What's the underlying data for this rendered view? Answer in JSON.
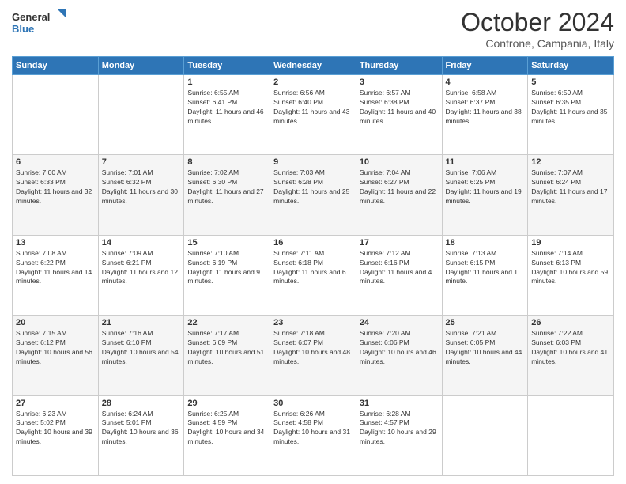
{
  "header": {
    "logo_line1": "General",
    "logo_line2": "Blue",
    "month": "October 2024",
    "location": "Controne, Campania, Italy"
  },
  "days_of_week": [
    "Sunday",
    "Monday",
    "Tuesday",
    "Wednesday",
    "Thursday",
    "Friday",
    "Saturday"
  ],
  "weeks": [
    [
      {
        "day": "",
        "info": ""
      },
      {
        "day": "",
        "info": ""
      },
      {
        "day": "1",
        "info": "Sunrise: 6:55 AM\nSunset: 6:41 PM\nDaylight: 11 hours and 46 minutes."
      },
      {
        "day": "2",
        "info": "Sunrise: 6:56 AM\nSunset: 6:40 PM\nDaylight: 11 hours and 43 minutes."
      },
      {
        "day": "3",
        "info": "Sunrise: 6:57 AM\nSunset: 6:38 PM\nDaylight: 11 hours and 40 minutes."
      },
      {
        "day": "4",
        "info": "Sunrise: 6:58 AM\nSunset: 6:37 PM\nDaylight: 11 hours and 38 minutes."
      },
      {
        "day": "5",
        "info": "Sunrise: 6:59 AM\nSunset: 6:35 PM\nDaylight: 11 hours and 35 minutes."
      }
    ],
    [
      {
        "day": "6",
        "info": "Sunrise: 7:00 AM\nSunset: 6:33 PM\nDaylight: 11 hours and 32 minutes."
      },
      {
        "day": "7",
        "info": "Sunrise: 7:01 AM\nSunset: 6:32 PM\nDaylight: 11 hours and 30 minutes."
      },
      {
        "day": "8",
        "info": "Sunrise: 7:02 AM\nSunset: 6:30 PM\nDaylight: 11 hours and 27 minutes."
      },
      {
        "day": "9",
        "info": "Sunrise: 7:03 AM\nSunset: 6:28 PM\nDaylight: 11 hours and 25 minutes."
      },
      {
        "day": "10",
        "info": "Sunrise: 7:04 AM\nSunset: 6:27 PM\nDaylight: 11 hours and 22 minutes."
      },
      {
        "day": "11",
        "info": "Sunrise: 7:06 AM\nSunset: 6:25 PM\nDaylight: 11 hours and 19 minutes."
      },
      {
        "day": "12",
        "info": "Sunrise: 7:07 AM\nSunset: 6:24 PM\nDaylight: 11 hours and 17 minutes."
      }
    ],
    [
      {
        "day": "13",
        "info": "Sunrise: 7:08 AM\nSunset: 6:22 PM\nDaylight: 11 hours and 14 minutes."
      },
      {
        "day": "14",
        "info": "Sunrise: 7:09 AM\nSunset: 6:21 PM\nDaylight: 11 hours and 12 minutes."
      },
      {
        "day": "15",
        "info": "Sunrise: 7:10 AM\nSunset: 6:19 PM\nDaylight: 11 hours and 9 minutes."
      },
      {
        "day": "16",
        "info": "Sunrise: 7:11 AM\nSunset: 6:18 PM\nDaylight: 11 hours and 6 minutes."
      },
      {
        "day": "17",
        "info": "Sunrise: 7:12 AM\nSunset: 6:16 PM\nDaylight: 11 hours and 4 minutes."
      },
      {
        "day": "18",
        "info": "Sunrise: 7:13 AM\nSunset: 6:15 PM\nDaylight: 11 hours and 1 minute."
      },
      {
        "day": "19",
        "info": "Sunrise: 7:14 AM\nSunset: 6:13 PM\nDaylight: 10 hours and 59 minutes."
      }
    ],
    [
      {
        "day": "20",
        "info": "Sunrise: 7:15 AM\nSunset: 6:12 PM\nDaylight: 10 hours and 56 minutes."
      },
      {
        "day": "21",
        "info": "Sunrise: 7:16 AM\nSunset: 6:10 PM\nDaylight: 10 hours and 54 minutes."
      },
      {
        "day": "22",
        "info": "Sunrise: 7:17 AM\nSunset: 6:09 PM\nDaylight: 10 hours and 51 minutes."
      },
      {
        "day": "23",
        "info": "Sunrise: 7:18 AM\nSunset: 6:07 PM\nDaylight: 10 hours and 48 minutes."
      },
      {
        "day": "24",
        "info": "Sunrise: 7:20 AM\nSunset: 6:06 PM\nDaylight: 10 hours and 46 minutes."
      },
      {
        "day": "25",
        "info": "Sunrise: 7:21 AM\nSunset: 6:05 PM\nDaylight: 10 hours and 44 minutes."
      },
      {
        "day": "26",
        "info": "Sunrise: 7:22 AM\nSunset: 6:03 PM\nDaylight: 10 hours and 41 minutes."
      }
    ],
    [
      {
        "day": "27",
        "info": "Sunrise: 6:23 AM\nSunset: 5:02 PM\nDaylight: 10 hours and 39 minutes."
      },
      {
        "day": "28",
        "info": "Sunrise: 6:24 AM\nSunset: 5:01 PM\nDaylight: 10 hours and 36 minutes."
      },
      {
        "day": "29",
        "info": "Sunrise: 6:25 AM\nSunset: 4:59 PM\nDaylight: 10 hours and 34 minutes."
      },
      {
        "day": "30",
        "info": "Sunrise: 6:26 AM\nSunset: 4:58 PM\nDaylight: 10 hours and 31 minutes."
      },
      {
        "day": "31",
        "info": "Sunrise: 6:28 AM\nSunset: 4:57 PM\nDaylight: 10 hours and 29 minutes."
      },
      {
        "day": "",
        "info": ""
      },
      {
        "day": "",
        "info": ""
      }
    ]
  ]
}
